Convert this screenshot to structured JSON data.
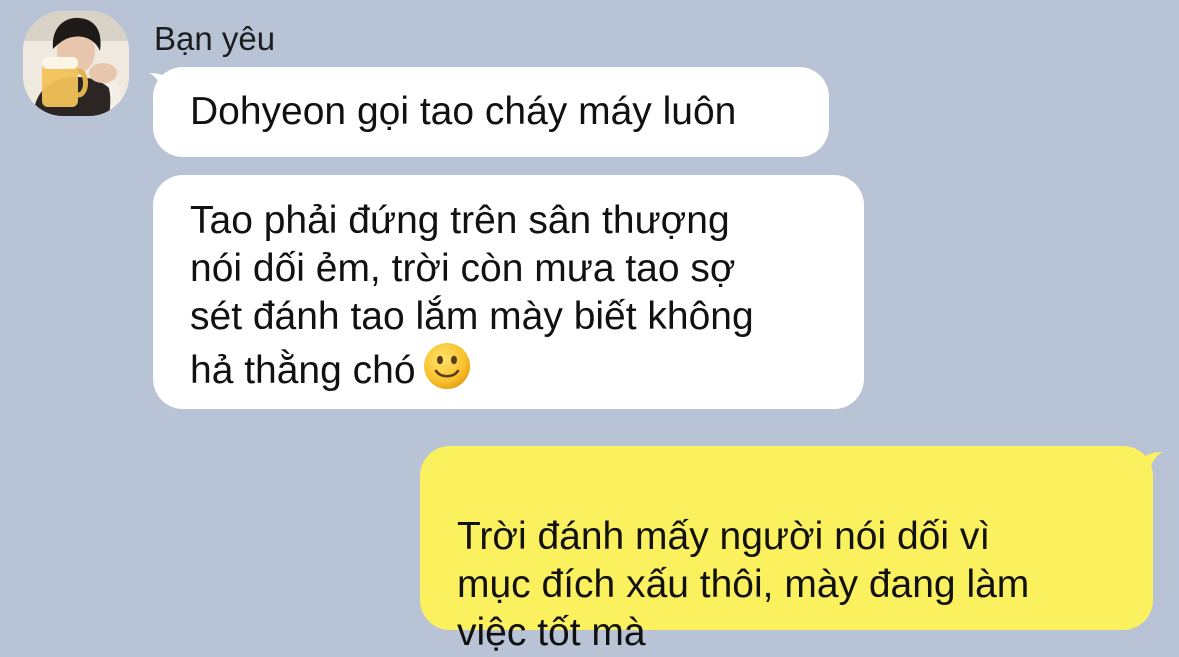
{
  "contact": {
    "name": "Bạn yêu",
    "avatar": "avatar-photo"
  },
  "messages": [
    {
      "direction": "incoming",
      "text": "Dohyeon gọi tao cháy máy luôn"
    },
    {
      "direction": "incoming",
      "text": "Tao phải đứng trên sân thượng\nnói dối ẻm, trời còn mưa tao sợ\nsét đánh tao lắm mày biết không\nhả thằng chó",
      "emoji": "slightly-smiling-face-icon"
    },
    {
      "direction": "outgoing",
      "text": "Trời đánh mấy người nói dối vì\nmục đích xấu thôi, mày đang làm\nviệc tốt mà"
    }
  ],
  "colors": {
    "background": "#b8c4d6",
    "incoming_bubble": "#ffffff",
    "outgoing_bubble": "#fbf15f",
    "text": "#111111"
  }
}
